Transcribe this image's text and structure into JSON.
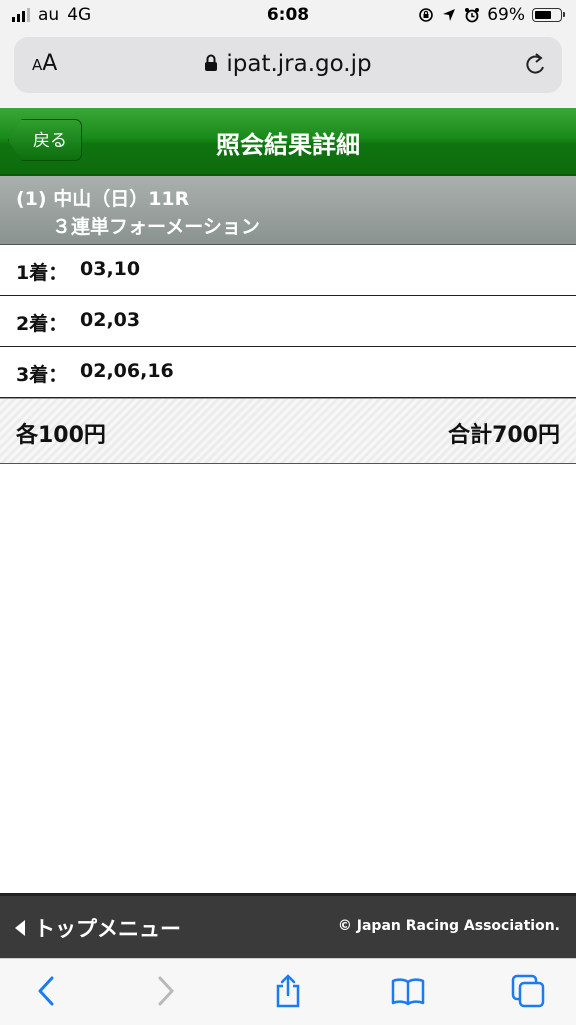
{
  "status_bar": {
    "carrier": "au",
    "network": "4G",
    "time": "6:08",
    "battery_percent": "69%",
    "battery_level": 0.69
  },
  "browser": {
    "aa_label_small": "A",
    "aa_label_large": "A",
    "url": "ipat.jra.go.jp"
  },
  "header": {
    "back_label": "戻る",
    "title": "照会結果詳細"
  },
  "race": {
    "line1": "(1) 中山（日）11R",
    "line2": "３連単フォーメーション"
  },
  "rows": [
    {
      "label": "1着：",
      "value": "03,10"
    },
    {
      "label": "2着：",
      "value": "02,03"
    },
    {
      "label": "3着：",
      "value": "02,06,16"
    }
  ],
  "summary": {
    "each": "各100円",
    "total": "合計700円"
  },
  "footer": {
    "top_menu": "トップメニュー",
    "copyright": "© Japan Racing Association."
  },
  "colors": {
    "header_green": "#1a8a1a",
    "toolbar_blue": "#1a7cf0"
  }
}
